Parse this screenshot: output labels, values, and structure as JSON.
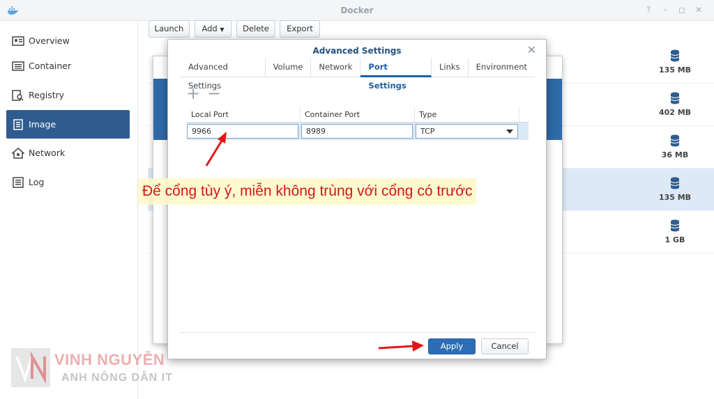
{
  "window": {
    "title": "Docker"
  },
  "sidebar": {
    "items": [
      {
        "label": "Overview",
        "icon": "overview-icon"
      },
      {
        "label": "Container",
        "icon": "container-icon"
      },
      {
        "label": "Registry",
        "icon": "registry-icon"
      },
      {
        "label": "Image",
        "icon": "image-icon",
        "active": true
      },
      {
        "label": "Network",
        "icon": "network-icon"
      },
      {
        "label": "Log",
        "icon": "log-icon"
      }
    ]
  },
  "toolbar": {
    "launch": "Launch",
    "add": "Add",
    "delete": "Delete",
    "export": "Export"
  },
  "images": {
    "sizes": [
      "135 MB",
      "402 MB",
      "36 MB",
      "135 MB",
      "1 GB"
    ]
  },
  "modal": {
    "title": "Advanced Settings",
    "tabs": [
      "Advanced Settings",
      "Volume",
      "Network",
      "Port Settings",
      "Links",
      "Environment"
    ],
    "active_tab": "Port Settings",
    "columns": [
      "Local Port",
      "Container Port",
      "Type"
    ],
    "row": {
      "local_port": "9966",
      "container_port": "8989",
      "type": "TCP"
    },
    "apply": "Apply",
    "cancel": "Cancel"
  },
  "annotation": {
    "text": "Để cổng tùy ý, miễn không trùng với cổng có trước"
  },
  "watermark": {
    "name": "VINH NGUYỄN",
    "subtitle": "ANH NÔNG DÂN IT"
  },
  "colors": {
    "accent": "#2f5c8e",
    "annotation": "#d31818",
    "arrow": "#e01818"
  }
}
